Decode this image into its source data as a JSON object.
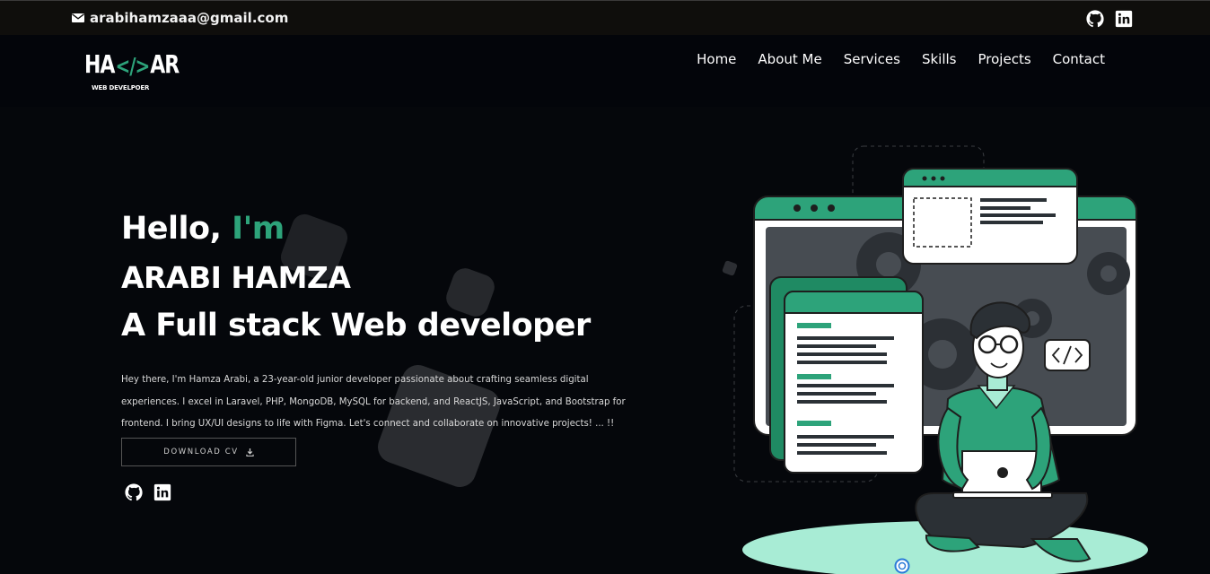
{
  "topbar": {
    "email": "arabihamzaaa@gmail.com",
    "social": [
      {
        "name": "github-icon"
      },
      {
        "name": "linkedin-icon"
      }
    ]
  },
  "logo": {
    "mark_left": "HA",
    "mark_code": "</>",
    "mark_right": "AR",
    "subtitle": "WEB DEVELPOER"
  },
  "nav": {
    "items": [
      "Home",
      "About Me",
      "Services",
      "Skills",
      "Projects",
      "Contact"
    ]
  },
  "hero": {
    "greeting": "Hello,",
    "greeting_accent": "I'm",
    "name": "ARABI HAMZA",
    "role": "A Full stack Web developer",
    "bio": "Hey there, I'm Hamza Arabi, a 23-year-old junior developer passionate about crafting seamless digital experiences. I excel in Laravel, PHP, MongoDB, MySQL for backend, and ReactJS, JavaScript, and Bootstrap for frontend. I bring UX/UI designs to life with Figma. Let's connect and collaborate on innovative projects! ... !!",
    "download_label": "DOWNLOAD CV"
  },
  "colors": {
    "accent": "#2da37a",
    "background": "#05070b",
    "topbar": "#0f0e0c"
  }
}
